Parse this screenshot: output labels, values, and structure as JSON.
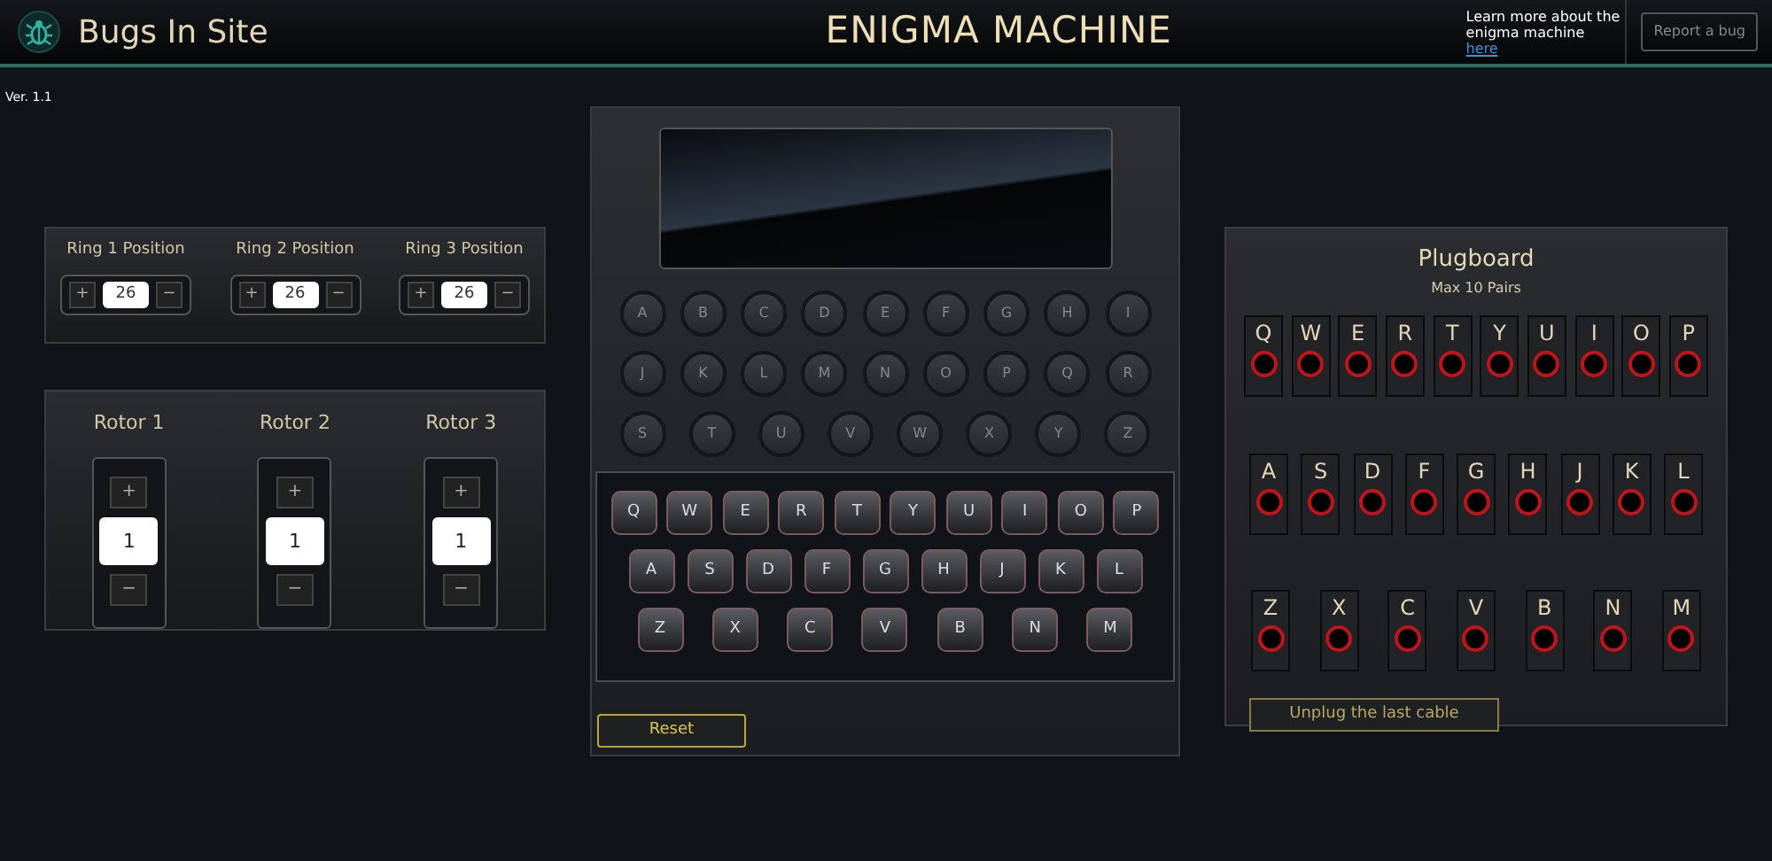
{
  "header": {
    "site_name": "Bugs In Site",
    "title": "ENIGMA MACHINE",
    "learn_more": "Learn more about the enigma machine",
    "learn_more_link": "here",
    "report_button": "Report a bug"
  },
  "version": "Ver. 1.1",
  "rings": [
    {
      "label": "Ring 1 Position",
      "plus": "+",
      "value": "26",
      "minus": "−"
    },
    {
      "label": "Ring 2 Position",
      "plus": "+",
      "value": "26",
      "minus": "−"
    },
    {
      "label": "Ring 3 Position",
      "plus": "+",
      "value": "26",
      "minus": "−"
    }
  ],
  "rotors": [
    {
      "label": "Rotor 1",
      "plus": "+",
      "value": "1",
      "minus": "−"
    },
    {
      "label": "Rotor 2",
      "plus": "+",
      "value": "1",
      "minus": "−"
    },
    {
      "label": "Rotor 3",
      "plus": "+",
      "value": "1",
      "minus": "−"
    }
  ],
  "lampboard": [
    [
      "A",
      "B",
      "C",
      "D",
      "E",
      "F",
      "G",
      "H",
      "I"
    ],
    [
      "J",
      "K",
      "L",
      "M",
      "N",
      "O",
      "P",
      "Q",
      "R"
    ],
    [
      "S",
      "T",
      "U",
      "V",
      "W",
      "X",
      "Y",
      "Z"
    ]
  ],
  "keyboard": [
    [
      "Q",
      "W",
      "E",
      "R",
      "T",
      "Y",
      "U",
      "I",
      "O",
      "P"
    ],
    [
      "A",
      "S",
      "D",
      "F",
      "G",
      "H",
      "J",
      "K",
      "L"
    ],
    [
      "Z",
      "X",
      "C",
      "V",
      "B",
      "N",
      "M"
    ]
  ],
  "reset_button": "Reset",
  "plugboard": {
    "title": "Plugboard",
    "subtitle": "Max 10 Pairs",
    "rows": [
      [
        "Q",
        "W",
        "E",
        "R",
        "T",
        "Y",
        "U",
        "I",
        "O",
        "P"
      ],
      [
        "A",
        "S",
        "D",
        "F",
        "G",
        "H",
        "J",
        "K",
        "L"
      ],
      [
        "Z",
        "X",
        "C",
        "V",
        "B",
        "N",
        "M"
      ]
    ],
    "unplug_button": "Unplug the last cable"
  }
}
